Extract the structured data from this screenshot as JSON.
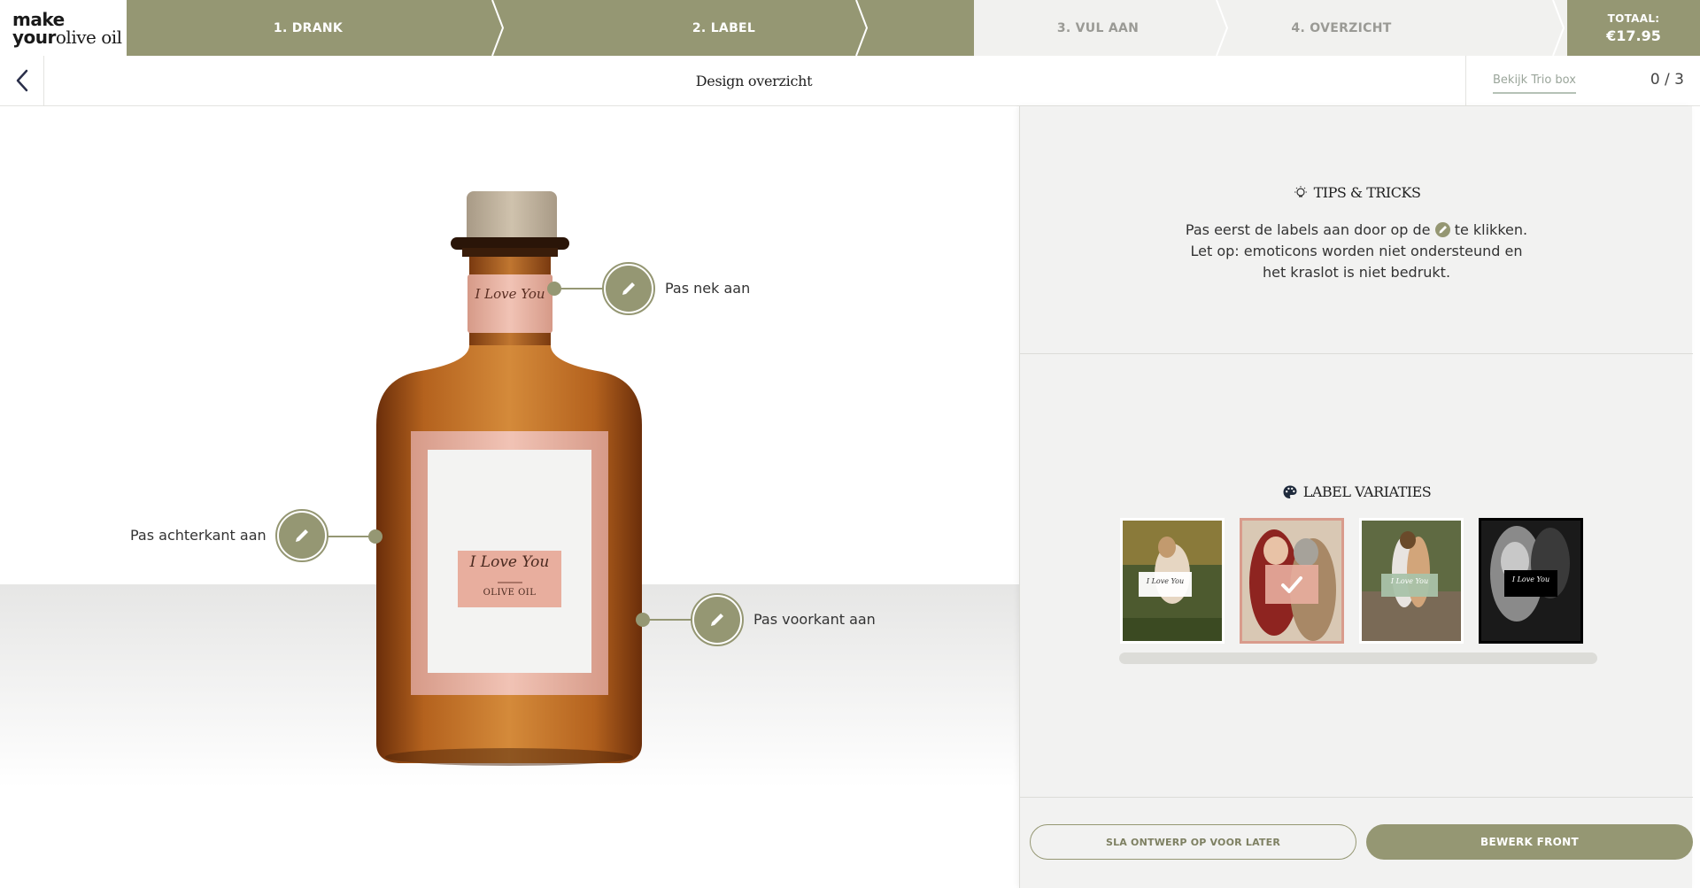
{
  "logo": {
    "line1": "make",
    "line2_bold": "your",
    "line2_serif": "olive oil"
  },
  "steps": [
    {
      "label": "1. DRANK",
      "state": "done"
    },
    {
      "label": "2. LABEL",
      "state": "active"
    },
    {
      "label": "3. VUL AAN",
      "state": "todo"
    },
    {
      "label": "4. OVERZICHT",
      "state": "todo"
    }
  ],
  "total": {
    "label": "TOTAAL:",
    "value": "€17.95"
  },
  "subheader": {
    "back_icon": "chevron-left-icon",
    "title": "Design overzicht",
    "trio_link": "Bekijk Trio box",
    "trio_count": "0 / 3"
  },
  "bottle": {
    "neck_text": "I Love You",
    "front_text": "I Love You",
    "front_subtext": "OLIVE OIL"
  },
  "callouts": {
    "neck": "Pas nek aan",
    "back": "Pas achterkant aan",
    "front": "Pas voorkant aan"
  },
  "tips": {
    "icon": "lightbulb-icon",
    "title": "TIPS & TRICKS",
    "line1_before": "Pas eerst de labels aan door op de",
    "line1_after": "te klikken.",
    "line2": "Let op: emoticons worden niet ondersteund en",
    "line3": "het kraslot is niet bedrukt."
  },
  "variations": {
    "icon": "palette-icon",
    "title": "LABEL VARIATIES",
    "items": [
      {
        "name": "variation-1",
        "label": "I Love You",
        "selected": false
      },
      {
        "name": "variation-2",
        "label": "I Love You",
        "selected": true
      },
      {
        "name": "variation-3",
        "label": "I Love You",
        "selected": false
      },
      {
        "name": "variation-4",
        "label": "I Love You",
        "selected": false
      }
    ]
  },
  "actions": {
    "save_later": "SLA ONTWERP OP VOOR LATER",
    "edit_front": "BEWERK FRONT"
  },
  "colors": {
    "accent": "#959773",
    "label_pink": "#e6a899",
    "bottle_amber": "#b5641f"
  }
}
